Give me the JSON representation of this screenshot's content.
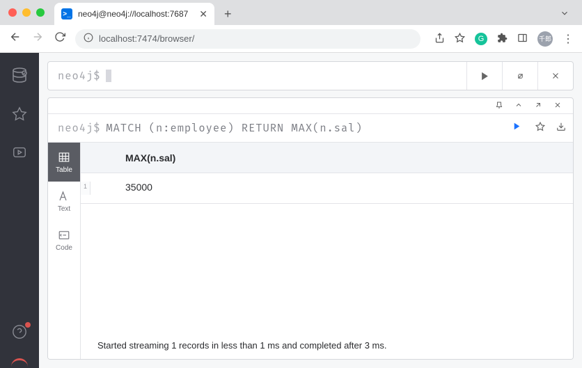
{
  "browser": {
    "tab_title": "neo4j@neo4j://localhost:7687",
    "url_host": "localhost",
    "url_port_path": ":7474/browser/",
    "avatar_text": "千郎"
  },
  "editor": {
    "prompt": "neo4j$"
  },
  "result": {
    "prompt": "neo4j$",
    "query": "MATCH (n:employee) RETURN MAX(n.sal)",
    "view_tabs": {
      "table": "Table",
      "text": "Text",
      "code": "Code"
    },
    "columns": [
      "MAX(n.sal)"
    ],
    "rows": [
      {
        "num": "1",
        "cells": [
          "35000"
        ]
      }
    ],
    "status": "Started streaming 1 records in less than 1 ms and completed after 3 ms."
  }
}
